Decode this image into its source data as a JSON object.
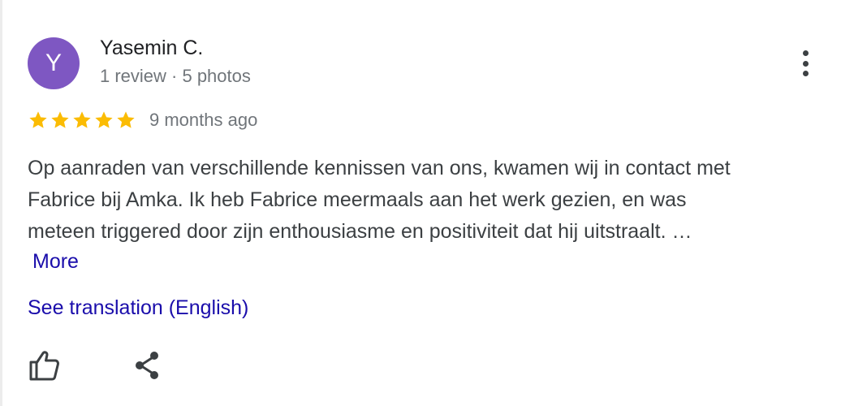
{
  "review": {
    "avatar_letter": "Y",
    "author_name": "Yasemin C.",
    "author_meta": "1 review · 5 photos",
    "rating": 5,
    "rating_max": 5,
    "time_ago": "9 months ago",
    "text_lines": [
      "Op aanraden van verschillende kennissen van ons, kwamen wij in contact met",
      "Fabrice bij Amka. Ik heb Fabrice meermaals aan het werk gezien, en was",
      "meteen triggered door zijn enthousiasme en positiviteit dat hij uitstraalt. …"
    ],
    "more_label": "More",
    "translate_label": "See translation (English)"
  },
  "colors": {
    "avatar_bg": "#7e57c2",
    "star": "#fbbc04",
    "link": "#1a0dab",
    "text": "#3c4043",
    "secondary_text": "#70757a"
  },
  "icons": {
    "menu": "more-vert-icon",
    "star": "star-icon",
    "like": "thumb-up-icon",
    "share": "share-icon"
  }
}
